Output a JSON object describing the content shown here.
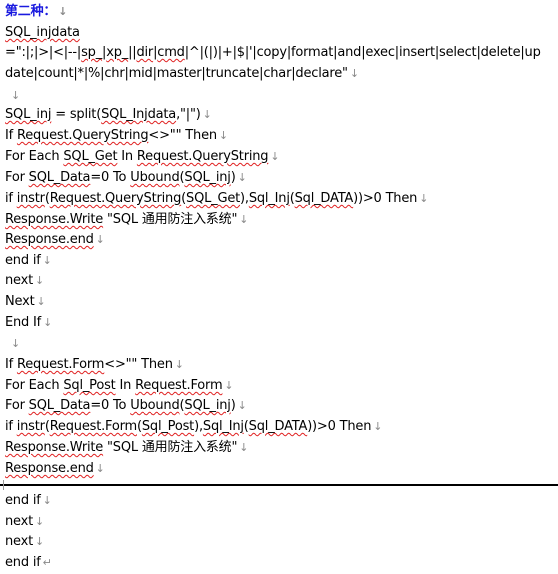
{
  "document": {
    "heading": "第二种：",
    "lines": [
      {
        "text": "SQL_injdata",
        "mark": ""
      },
      {
        "text": "=\":|;|>|<|--|sp_|xp_||dir|cmd|^|(|)|+|$|'|copy|format|and|exec|insert|select|delete|up",
        "mark": ""
      },
      {
        "text": "date|count|*|%|chr|mid|master|truncate|char|declare\"",
        "mark": "↓"
      },
      {
        "text": "",
        "mark": "↓"
      },
      {
        "text": "SQL_inj = split(SQL_Injdata,\"|\")",
        "mark": "↓"
      },
      {
        "text": "If Request.QueryString<>\"\" Then",
        "mark": "↓"
      },
      {
        "text": "For Each SQL_Get In Request.QueryString",
        "mark": "↓"
      },
      {
        "text": "For SQL_Data=0 To Ubound(SQL_inj)",
        "mark": "↓"
      },
      {
        "text": "if instr(Request.QueryString(SQL_Get),Sql_Inj(Sql_DATA))>0 Then",
        "mark": "↓"
      },
      {
        "text": "Response.Write \"SQL 通用防注入系统\"",
        "mark": "↓"
      },
      {
        "text": "Response.end",
        "mark": "↓"
      },
      {
        "text": "end if",
        "mark": "↓"
      },
      {
        "text": "next",
        "mark": "↓"
      },
      {
        "text": "Next",
        "mark": "↓"
      },
      {
        "text": "End If",
        "mark": "↓"
      },
      {
        "text": "",
        "mark": "↓"
      },
      {
        "text": "If Request.Form<>\"\" Then",
        "mark": "↓"
      },
      {
        "text": "For Each Sql_Post In Request.Form",
        "mark": "↓"
      },
      {
        "text": "For SQL_Data=0 To Ubound(SQL_inj)",
        "mark": "↓"
      },
      {
        "text": "if instr(Request.Form(Sql_Post),Sql_Inj(Sql_DATA))>0 Then",
        "mark": "↓"
      },
      {
        "text": "Response.Write \"SQL 通用防注入系统\"",
        "mark": "↓"
      },
      {
        "text": "Response.end",
        "mark": "↓"
      },
      {
        "text": "end if",
        "mark": "↓"
      },
      {
        "text": "next",
        "mark": "↓"
      },
      {
        "text": "next",
        "mark": "↓"
      },
      {
        "text": "end if",
        "mark": "↵"
      }
    ],
    "heading_mark": "↓"
  }
}
